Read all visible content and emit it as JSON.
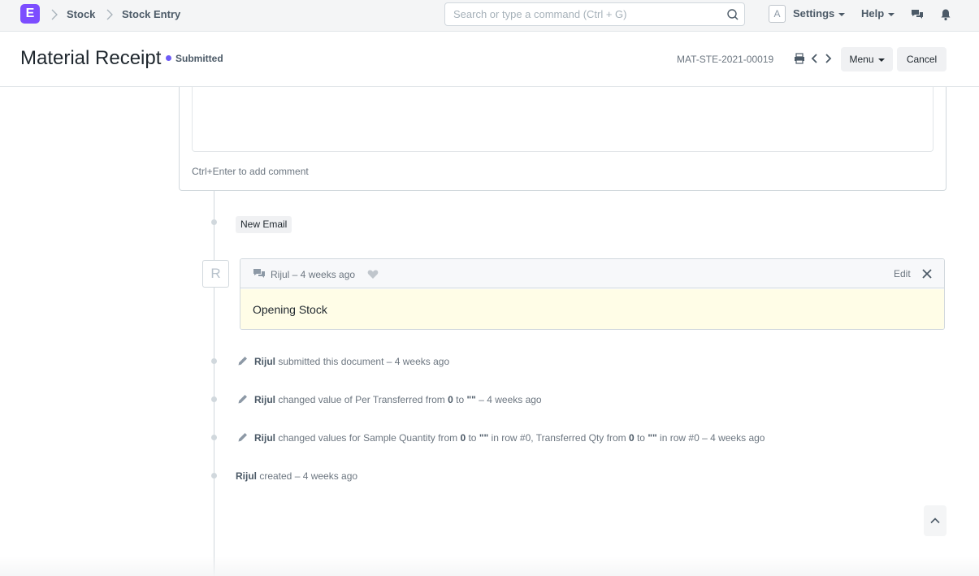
{
  "navbar": {
    "logo_letter": "E",
    "breadcrumbs": [
      {
        "label": "Stock"
      },
      {
        "label": "Stock Entry"
      }
    ],
    "search": {
      "placeholder": "Search or type a command (Ctrl + G)",
      "value": ""
    },
    "avatar_letter": "A",
    "settings_label": "Settings",
    "help_label": "Help",
    "icons": [
      "search-icon",
      "chat-icon",
      "bell-icon"
    ]
  },
  "page": {
    "title": "Material Receipt",
    "status": "Submitted",
    "status_color": "#6e5cf6",
    "doc_name": "MAT-STE-2021-00019",
    "menu_label": "Menu",
    "cancel_label": "Cancel"
  },
  "comment_box": {
    "hint": "Ctrl+Enter to add comment"
  },
  "timeline": {
    "new_email_label": "New Email",
    "comment": {
      "avatar_letter": "R",
      "meta": "Rijul – 4 weeks ago",
      "edit_label": "Edit",
      "text": "Opening Stock"
    },
    "events": [
      {
        "user": "Rijul",
        "text": " submitted this document – 4 weeks ago"
      },
      {
        "user": "Rijul",
        "t1": " changed value of Per Transferred from ",
        "v1": "0",
        "t2": " to ",
        "v2": "\"\"",
        "t3": " – 4 weeks ago"
      },
      {
        "user": "Rijul",
        "t1": " changed values for Sample Quantity from ",
        "v1": "0",
        "t2": " to ",
        "v2": "\"\"",
        "t3": " in row #0, Transferred Qty from ",
        "v3": "0",
        "t4": " to ",
        "v4": "\"\"",
        "t5": " in row #0 – 4 weeks ago"
      },
      {
        "user": "Rijul",
        "text": " created – 4 weeks ago"
      }
    ]
  },
  "colors": {
    "brand": "#7c4dff",
    "comment_bg": "#fffde7"
  }
}
